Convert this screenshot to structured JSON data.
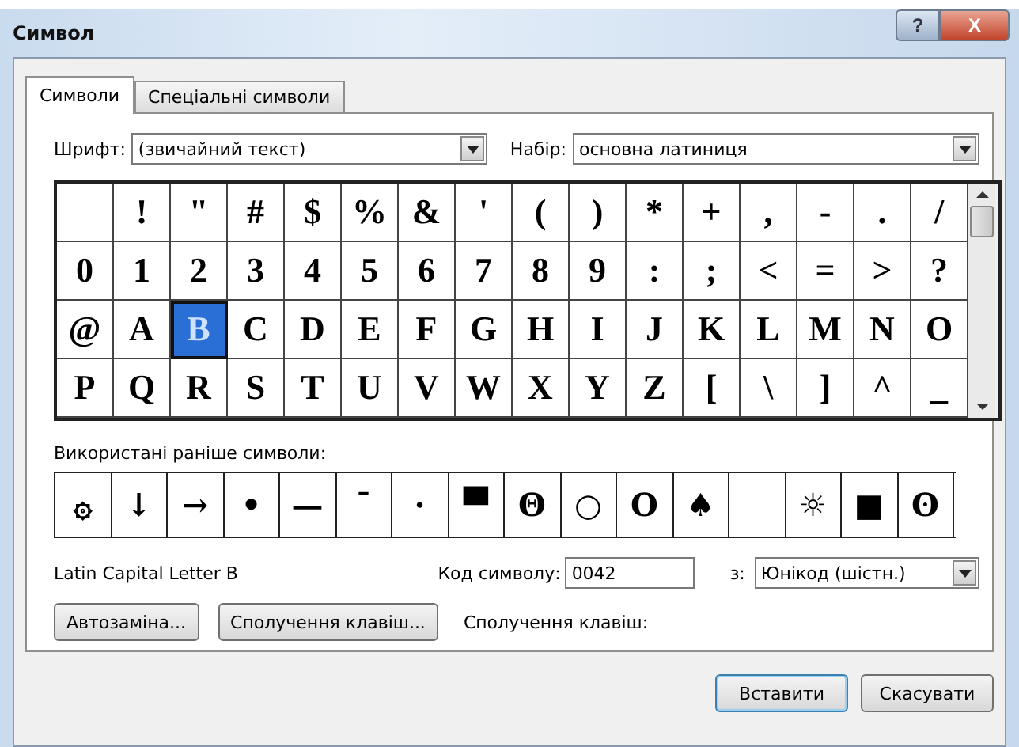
{
  "window": {
    "title": "Символ"
  },
  "caption_buttons": [
    {
      "kind": "help",
      "label": "?"
    },
    {
      "kind": "close",
      "label": "X"
    }
  ],
  "tabs": [
    {
      "label": "Символи",
      "selected": true
    },
    {
      "label": "Спеціальні символи",
      "selected": false
    }
  ],
  "font": {
    "label": "Шрифт:",
    "value": "(звичайний текст)"
  },
  "subset": {
    "label": "Набір:",
    "value": "основна латиниця"
  },
  "symbols": [
    {
      "kind": "blank",
      "selected": false
    },
    {
      "char": "!",
      "selected": false
    },
    {
      "char": "\"",
      "selected": false
    },
    {
      "char": "#",
      "selected": false
    },
    {
      "char": "$",
      "selected": false
    },
    {
      "char": "%",
      "selected": false
    },
    {
      "char": "&",
      "selected": false
    },
    {
      "char": "'",
      "selected": false
    },
    {
      "char": "(",
      "selected": false
    },
    {
      "char": ")",
      "selected": false
    },
    {
      "char": "*",
      "selected": false
    },
    {
      "char": "+",
      "selected": false
    },
    {
      "char": ",",
      "selected": false
    },
    {
      "char": "-",
      "selected": false
    },
    {
      "char": ".",
      "selected": false
    },
    {
      "char": "/",
      "selected": false
    },
    {
      "char": "0",
      "selected": false
    },
    {
      "char": "1",
      "selected": false
    },
    {
      "char": "2",
      "selected": false
    },
    {
      "char": "3",
      "selected": false
    },
    {
      "char": "4",
      "selected": false
    },
    {
      "char": "5",
      "selected": false
    },
    {
      "char": "6",
      "selected": false
    },
    {
      "char": "7",
      "selected": false
    },
    {
      "char": "8",
      "selected": false
    },
    {
      "char": "9",
      "selected": false
    },
    {
      "char": ":",
      "selected": false
    },
    {
      "char": ";",
      "selected": false
    },
    {
      "char": "<",
      "selected": false
    },
    {
      "char": "=",
      "selected": false
    },
    {
      "char": ">",
      "selected": false
    },
    {
      "char": "?",
      "selected": false
    },
    {
      "char": "@",
      "selected": false
    },
    {
      "char": "A",
      "selected": false
    },
    {
      "char": "B",
      "selected": true
    },
    {
      "char": "C",
      "selected": false
    },
    {
      "char": "D",
      "selected": false
    },
    {
      "char": "E",
      "selected": false
    },
    {
      "char": "F",
      "selected": false
    },
    {
      "char": "G",
      "selected": false
    },
    {
      "char": "H",
      "selected": false
    },
    {
      "char": "I",
      "selected": false
    },
    {
      "char": "J",
      "selected": false
    },
    {
      "char": "K",
      "selected": false
    },
    {
      "char": "L",
      "selected": false
    },
    {
      "char": "M",
      "selected": false
    },
    {
      "char": "N",
      "selected": false
    },
    {
      "char": "O",
      "selected": false
    },
    {
      "char": "P",
      "selected": false
    },
    {
      "char": "Q",
      "selected": false
    },
    {
      "char": "R",
      "selected": false
    },
    {
      "char": "S",
      "selected": false
    },
    {
      "char": "T",
      "selected": false
    },
    {
      "char": "U",
      "selected": false
    },
    {
      "char": "V",
      "selected": false
    },
    {
      "char": "W",
      "selected": false
    },
    {
      "char": "X",
      "selected": false
    },
    {
      "char": "Y",
      "selected": false
    },
    {
      "char": "Z",
      "selected": false
    },
    {
      "char": "[",
      "selected": false
    },
    {
      "char": "\\",
      "selected": false
    },
    {
      "char": "]",
      "selected": false
    },
    {
      "char": "^",
      "selected": false
    },
    {
      "char": "_",
      "selected": false
    }
  ],
  "recent": {
    "label": "Використані раніше символи:",
    "symbols": [
      {
        "char": "۞"
      },
      {
        "char": "↓"
      },
      {
        "char": "→"
      },
      {
        "char": "•"
      },
      {
        "char": "—"
      },
      {
        "char": "¯"
      },
      {
        "char": "·"
      },
      {
        "char": "▀"
      },
      {
        "char": "Θ"
      },
      {
        "char": "○"
      },
      {
        "char": "O"
      },
      {
        "char": "♠"
      },
      {
        "kind": "blank"
      },
      {
        "char": "☼"
      },
      {
        "char": "■"
      },
      {
        "char": "ʘ"
      }
    ]
  },
  "char_name": "Latin Capital Letter B",
  "code": {
    "label": "Код символу:",
    "value": "0042"
  },
  "from": {
    "label": "з:",
    "value": "Юнікод (шістн.)"
  },
  "actions": [
    {
      "label": "Автозаміна..."
    },
    {
      "label": "Сполучення клавіш..."
    }
  ],
  "shortcut_label": "Сполучення клавіш:",
  "buttons": [
    {
      "label": "Вставити",
      "default": true
    },
    {
      "label": "Скасувати",
      "default": false
    }
  ]
}
